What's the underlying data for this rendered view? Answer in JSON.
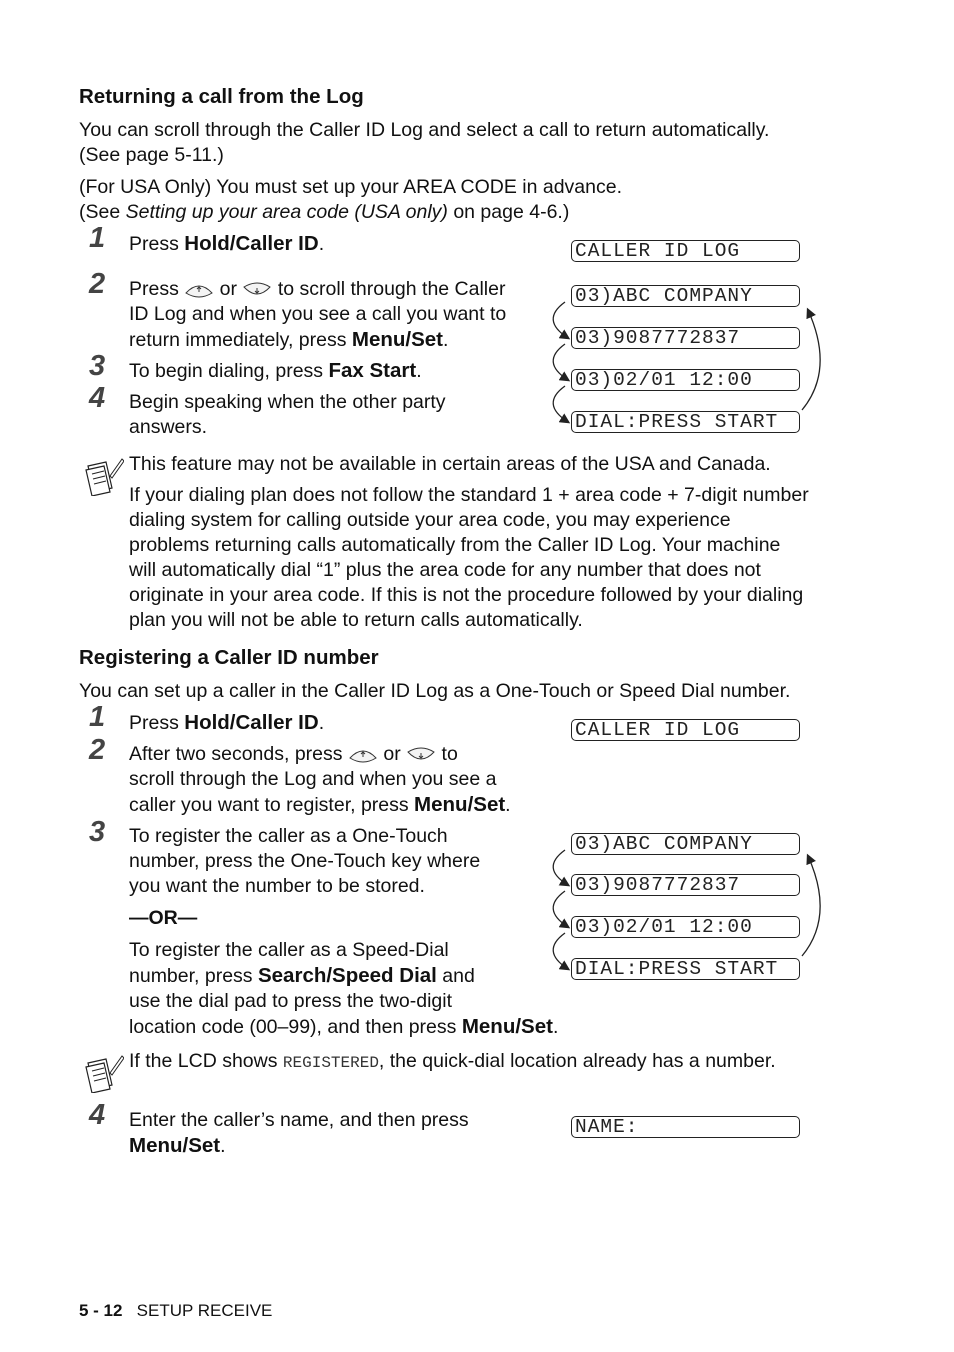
{
  "section1": {
    "heading": "Returning a call from the Log",
    "intro1_line1": "You can scroll through the Caller ID Log and select a call to return automatically.",
    "intro1_line2": "(See page 5-11.)",
    "intro2_line1": "(For USA Only) You must set up your AREA CODE in advance.",
    "intro2_pre": "(See ",
    "intro2_italic": "Setting up your area code (USA only)",
    "intro2_post": " on page 4-6.)",
    "steps": [
      {
        "num": "1",
        "pre": "Press ",
        "bold": "Hold/Caller ID",
        "post": "."
      },
      {
        "num": "2",
        "pre": "Press ",
        "mid": " or ",
        "post1": " to scroll through the Caller",
        "line2": "ID Log and when you see a call you want to",
        "line3_pre": "return immediately, press ",
        "bold": "Menu/Set",
        "post": "."
      },
      {
        "num": "3",
        "pre": "To begin dialing, press ",
        "bold": "Fax Start",
        "post": "."
      },
      {
        "num": "4",
        "line1": "Begin speaking when the other party",
        "line2": "answers."
      }
    ],
    "lcd_title": "CALLER ID LOG",
    "lcd_cycle": [
      "03)ABC COMPANY",
      "03)9087772837",
      "03)02/01 12:00",
      "DIAL:PRESS START"
    ],
    "note_lines": [
      "This feature may not be available in certain areas of the USA and Canada.",
      "If your dialing plan does not follow the standard 1 + area code + 7-digit number",
      "dialing system for calling outside your area code, you may experience",
      "problems returning calls automatically from the Caller ID Log. Your machine",
      "will automatically dial “1” plus the area code for any number that does not",
      "originate in your area code. If this is not the procedure followed by your dialing",
      "plan you will not be able to return calls automatically."
    ]
  },
  "section2": {
    "heading": "Registering a Caller ID number",
    "intro": "You can set up a caller in the Caller ID Log as a One-Touch or Speed Dial number.",
    "step1": {
      "num": "1",
      "pre": "Press ",
      "bold": "Hold/Caller ID",
      "post": "."
    },
    "step2": {
      "num": "2",
      "pre": "After two seconds, press ",
      "mid": " or ",
      "post1": " to",
      "line2": "scroll through the Log and when you see a",
      "line3_pre": "caller you want to register, press ",
      "bold": "Menu/Set",
      "post": "."
    },
    "step3": {
      "num": "3",
      "line1": "To register the caller as a One-Touch",
      "line2": "number, press the One-Touch key where",
      "line3": "you want the number to be stored.",
      "or": "—OR—",
      "alt_line1": "To register the caller as a Speed-Dial",
      "alt_line2_pre": "number, press ",
      "alt_line2_bold": "Search/Speed Dial",
      "alt_line2_post": " and",
      "alt_line3": "use the dial pad to press the two-digit",
      "alt_line4_pre": "location code (00–99), and then press ",
      "alt_line4_bold": "Menu/Set",
      "alt_line4_post": "."
    },
    "lcd_title": "CALLER ID LOG",
    "lcd_cycle": [
      "03)ABC COMPANY",
      "03)9087772837",
      "03)02/01 12:00",
      "DIAL:PRESS START"
    ],
    "note_pre": "If the LCD shows ",
    "note_mono": "REGISTERED",
    "note_post": ", the quick-dial location already has a number.",
    "step4": {
      "num": "4",
      "line1": "Enter the caller’s name, and then press",
      "bold": "Menu/Set",
      "post": "."
    },
    "lcd_name": "NAME:"
  },
  "footer": {
    "page": "5 - 12",
    "chapter": "SETUP RECEIVE"
  }
}
